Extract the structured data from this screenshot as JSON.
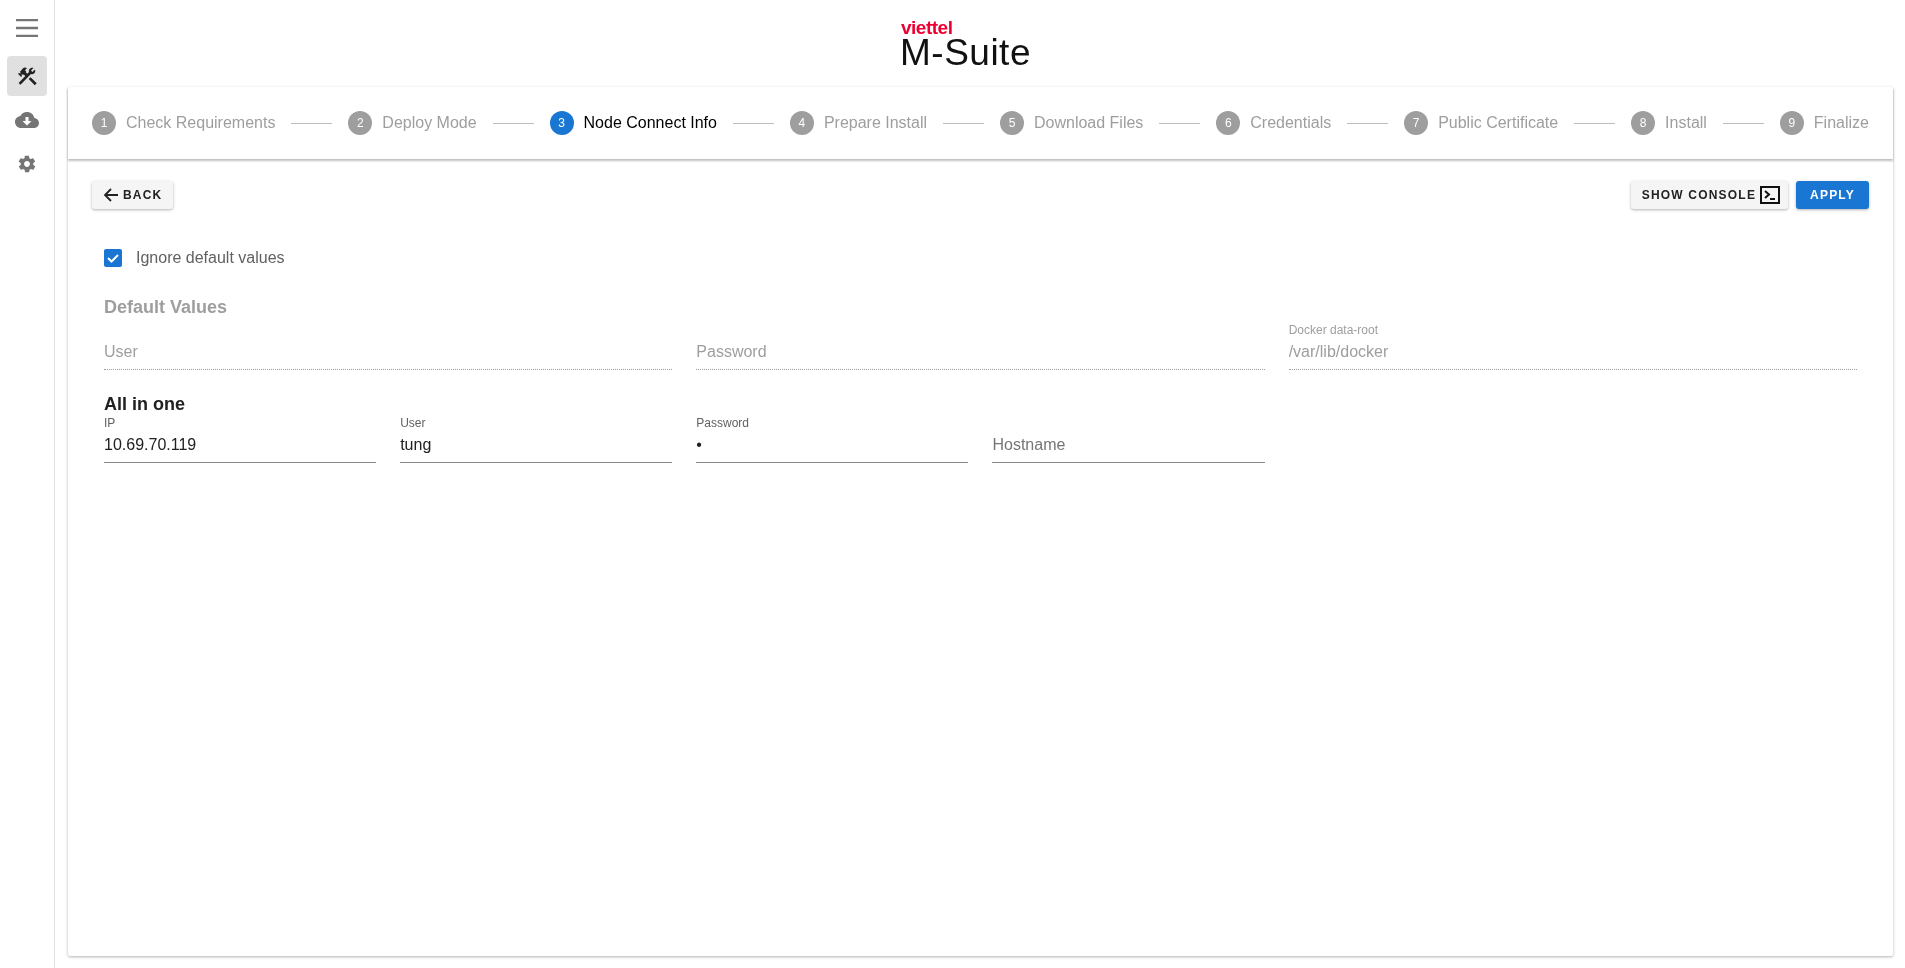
{
  "sidebar": {
    "items": [
      {
        "selected": true
      },
      {
        "selected": false
      },
      {
        "selected": false
      }
    ]
  },
  "logo": {
    "brand": "viettel",
    "product": "M-Suite"
  },
  "stepper": {
    "steps": [
      {
        "number": "1",
        "label": "Check Requirements",
        "selected": false
      },
      {
        "number": "2",
        "label": "Deploy Mode",
        "selected": false
      },
      {
        "number": "3",
        "label": "Node Connect Info",
        "selected": true
      },
      {
        "number": "4",
        "label": "Prepare Install",
        "selected": false
      },
      {
        "number": "5",
        "label": "Download Files",
        "selected": false
      },
      {
        "number": "6",
        "label": "Credentials",
        "selected": false
      },
      {
        "number": "7",
        "label": "Public Certificate",
        "selected": false
      },
      {
        "number": "8",
        "label": "Install",
        "selected": false
      },
      {
        "number": "9",
        "label": "Finalize",
        "selected": false
      }
    ]
  },
  "toolbar": {
    "back": "BACK",
    "show_console": "SHOW CONSOLE",
    "apply": "APPLY"
  },
  "ignore_defaults": {
    "label": "Ignore default values",
    "checked": true
  },
  "default_values": {
    "title": "Default Values",
    "fields": [
      {
        "placeholder": "User",
        "disabled": true
      },
      {
        "placeholder": "Password",
        "disabled": true
      },
      {
        "label": "Docker data-root",
        "value": "/var/lib/docker",
        "disabled": true
      }
    ]
  },
  "all_in_one": {
    "title": "All in one",
    "fields": [
      {
        "label": "IP",
        "value": "10.69.70.119",
        "disabled": false
      },
      {
        "label": "User",
        "value": "tung",
        "disabled": false
      },
      {
        "label": "Password",
        "value": "•",
        "disabled": false
      },
      {
        "placeholder": "Hostname",
        "disabled": false
      }
    ]
  }
}
